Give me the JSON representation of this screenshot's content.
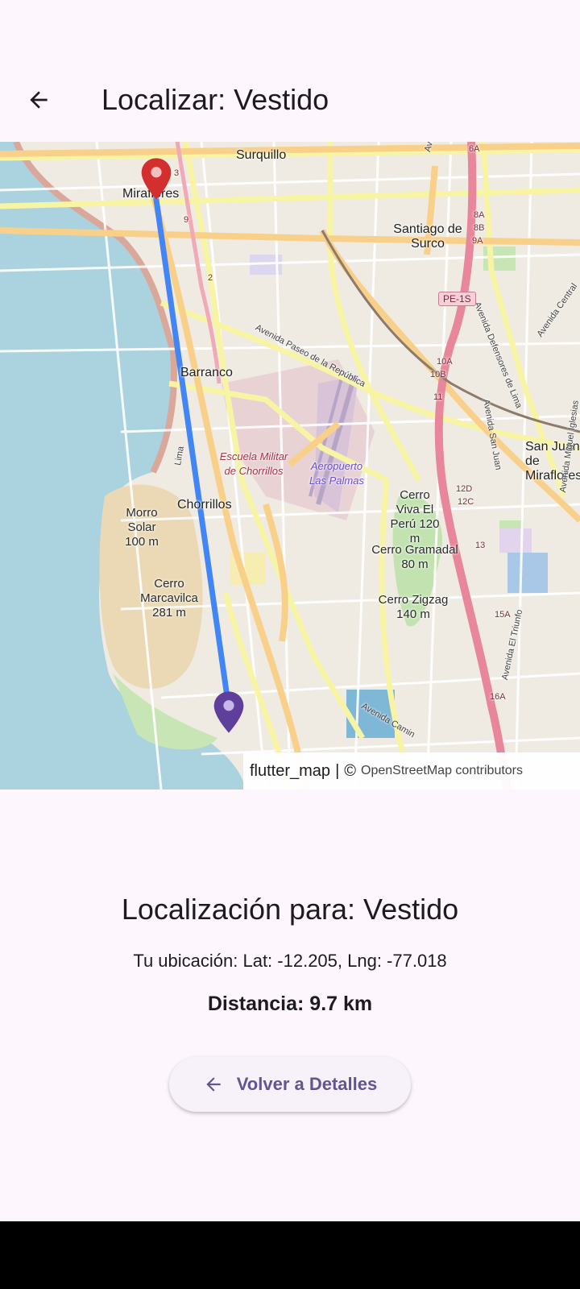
{
  "appbar": {
    "title": "Localizar: Vestido",
    "back_icon": "arrow-left-icon"
  },
  "map": {
    "places": {
      "miraflores": "Miraflores",
      "surquillo": "Surquillo",
      "santiago_de_surco": "Santiago de Surco",
      "barranco": "Barranco",
      "chorrillos": "Chorrillos",
      "san_juan_miraflores": "San Juan de Miraflores",
      "escuela_militar": "Escuela Militar de Chorrillos",
      "aeropuerto": "Aeropuerto Las Palmas",
      "morro_solar": "Morro Solar 100 m",
      "cerro_marcavilca": "Cerro Marcavilca 281 m",
      "cerro_viva": "Cerro Viva El Perú 120 m",
      "cerro_gramadal": "Cerro Gramadal 80 m",
      "cerro_zigzag": "Cerro Zigzag 140 m"
    },
    "roads": {
      "paseo_republica": "Avenida Paseo de la República",
      "velasco_astete": "Avenida Velasco Astete",
      "defensores_lima": "Avenida Defensores de Lima",
      "san_juan": "Avenida San Juan",
      "miguel_iglesias": "Avenida Miguel Iglesias",
      "el_triunfo": "Avenida El Triunfo",
      "central": "Avenida Central",
      "camino": "Avenida Camin",
      "lima": "Lima",
      "pe_1s": "PE-1S"
    },
    "exits": [
      "3",
      "9",
      "2",
      "6A",
      "8A",
      "8B",
      "9A",
      "10A",
      "10B",
      "11",
      "12D",
      "12C",
      "13",
      "15A",
      "16A"
    ],
    "markers": {
      "destination_icon": "red-location-pin-icon",
      "user_icon": "purple-location-pin-icon",
      "route_color": "#4285f4"
    },
    "attribution": {
      "main": "flutter_map",
      "separator": "|",
      "copyright": "©",
      "link": "OpenStreetMap contributors"
    }
  },
  "info": {
    "title": "Localización para: Vestido",
    "location": "Tu ubicación: Lat: -12.205, Lng: -77.018",
    "distance": "Distancia: 9.7 km"
  },
  "back_button": {
    "label": "Volver a Detalles",
    "icon": "arrow-left-icon"
  },
  "colors": {
    "background": "#fdf7fd",
    "primary": "#65558f",
    "sea": "#aad3df",
    "destination_marker": "#d32f2f",
    "user_marker": "#5e3f9c"
  }
}
